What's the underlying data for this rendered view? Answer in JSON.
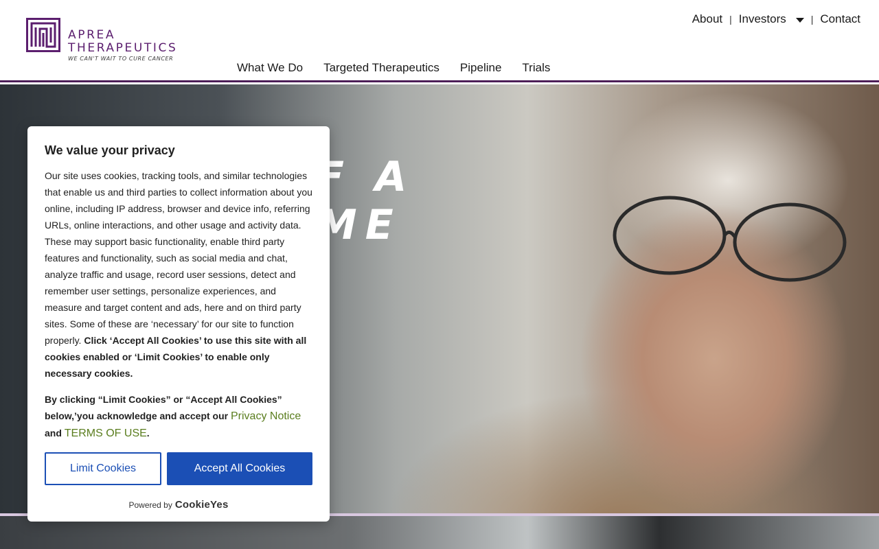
{
  "brand": {
    "name_line1": "APREA",
    "name_line2": "THERAPEUTICS",
    "tagline": "WE CAN'T WAIT TO CURE CANCER",
    "accent_color": "#5b1e6e",
    "logo_icon": "maze-logo-icon"
  },
  "util_nav": {
    "about": "About",
    "investors": "Investors",
    "contact": "Contact",
    "separator": "|"
  },
  "main_nav": {
    "items": [
      "What We Do",
      "Targeted Therapeutics",
      "Pipeline",
      "Trials"
    ]
  },
  "hero": {
    "headline_visible": "F A\nME"
  },
  "cookie": {
    "title": "We value your privacy",
    "body": "Our site uses cookies, tracking tools, and similar technologies that enable us and third parties to collect information about you online, including IP address, browser and device info, referring URLs, online interactions, and other usage and activity data. These may support basic functionality, enable third party features and functionality, such as social media and chat, analyze traffic and usage, record user sessions, detect and remember user settings, personalize experiences, and measure and target content and ads, here and on third party sites. Some of these are ‘necessary’ for our site to function properly.",
    "body_bold": "Click ‘Accept All Cookies’ to use this site with all cookies enabled or ‘Limit Cookies’ to enable only necessary cookies.",
    "ack_prefix": "By clicking “Limit Cookies” or “Accept All Cookies” below,’you acknowledge and accept our",
    "privacy_link": "Privacy Notice",
    "and": "and",
    "terms_link": "TERMS OF USE",
    "period": ".",
    "limit_button": "Limit Cookies",
    "accept_button": "Accept All Cookies",
    "powered_by": "Powered by",
    "powered_brand": "CookieYes",
    "button_color": "#1b4fb5",
    "link_color": "#5a7d1e"
  }
}
